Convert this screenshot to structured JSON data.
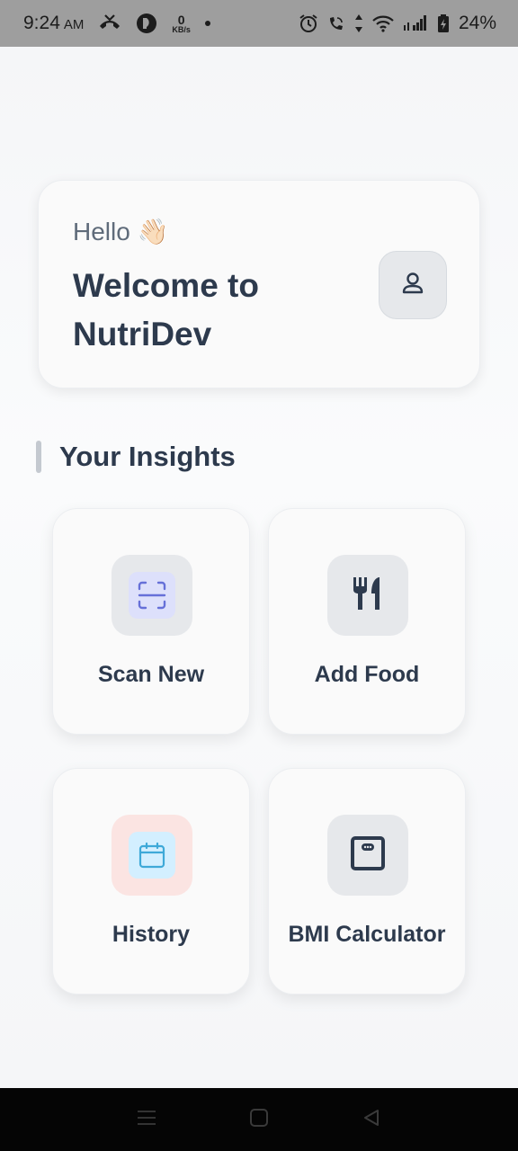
{
  "status_bar": {
    "time": "9:24",
    "ampm": "AM",
    "net_speed": "0",
    "net_unit": "KB/s",
    "battery": "24%"
  },
  "welcome": {
    "hello": "Hello 👋🏻",
    "title": "Welcome to NutriDev",
    "profile_icon": "user-icon"
  },
  "insights": {
    "title": "Your Insights",
    "tiles": [
      {
        "label": "Scan New",
        "icon": "scan-icon",
        "bg": "#e6e8eb",
        "inner": "#dde0fb",
        "color": "#6670d8"
      },
      {
        "label": "Add Food",
        "icon": "utensils-icon",
        "bg": "#e6e8eb",
        "inner": "",
        "color": "#2d3a4d"
      },
      {
        "label": "History",
        "icon": "calendar-icon",
        "bg": "#fbe4e2",
        "inner": "#d3efff",
        "color": "#3ea9d8"
      },
      {
        "label": "BMI Calculator",
        "icon": "scale-icon",
        "bg": "#e6e8eb",
        "inner": "",
        "color": "#2d3a4d"
      }
    ]
  },
  "nav": {
    "menu_icon": "menu-icon",
    "home_icon": "home-square-icon",
    "back_icon": "back-triangle-icon"
  }
}
